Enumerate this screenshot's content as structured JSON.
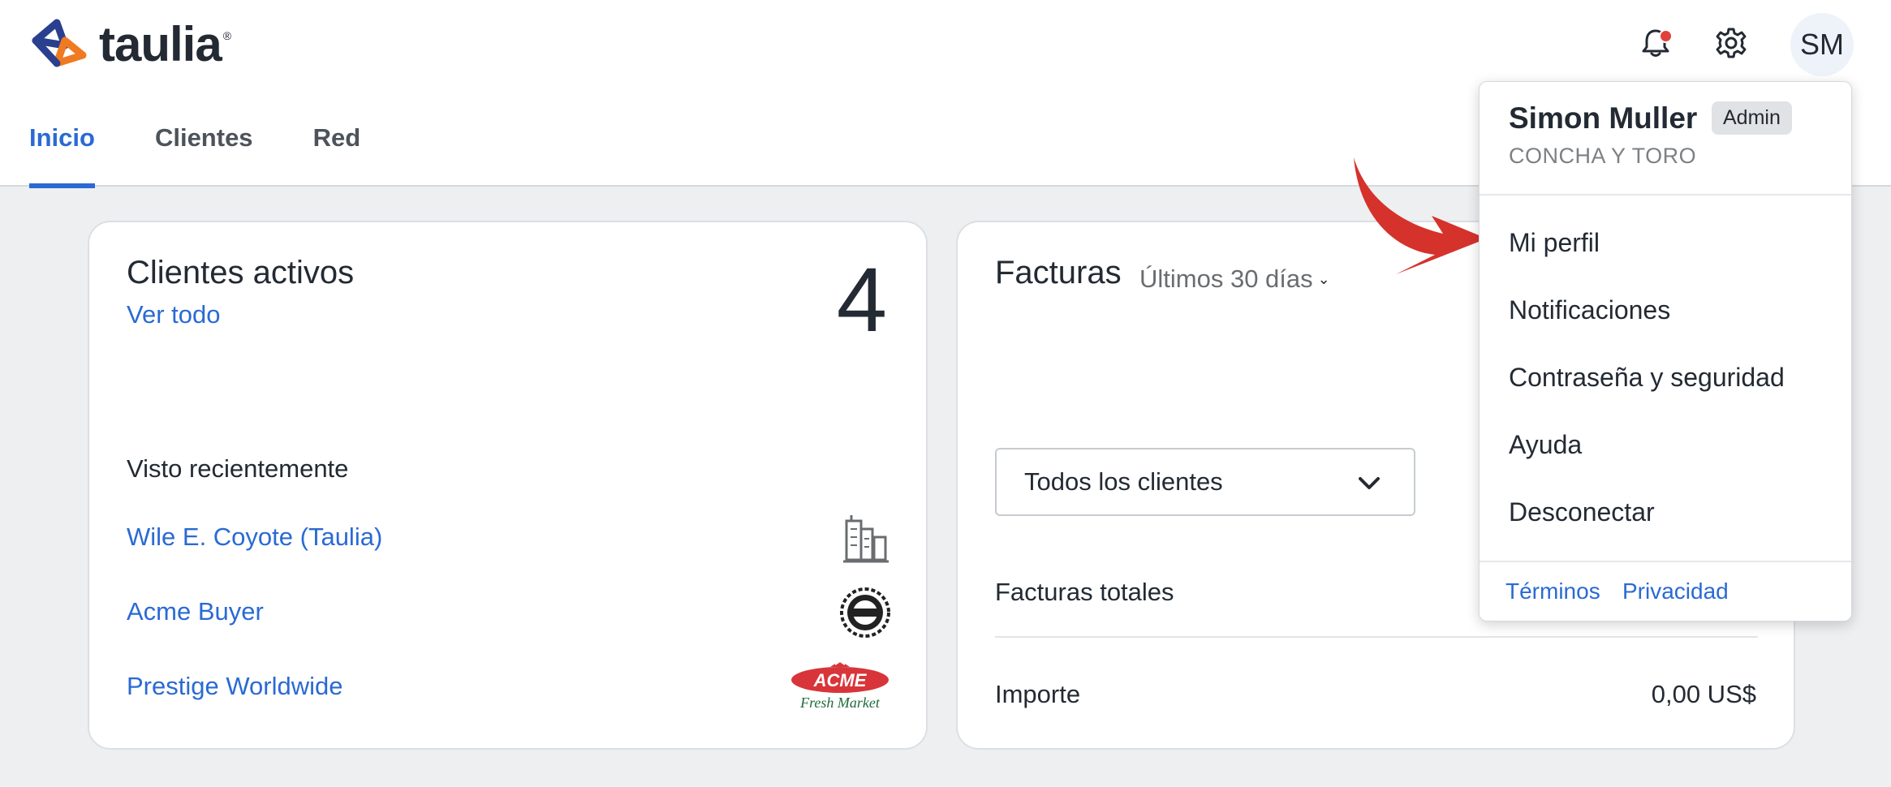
{
  "header": {
    "brand": "taulia",
    "brand_reg": "®",
    "avatar_initials": "SM",
    "notification_dot_color": "#e0423b"
  },
  "tabs": [
    {
      "label": "Inicio",
      "active": true
    },
    {
      "label": "Clientes",
      "active": false
    },
    {
      "label": "Red",
      "active": false
    }
  ],
  "active_clients": {
    "title": "Clientes activos",
    "view_all": "Ver todo",
    "count": "4",
    "recent_label": "Visto recientemente",
    "recent": [
      {
        "name": "Wile E. Coyote (Taulia)",
        "icon": "building-icon"
      },
      {
        "name": "Acme Buyer",
        "icon": "acme-seal-logo"
      },
      {
        "name": "Prestige Worldwide",
        "icon": "acme-fresh-market-logo",
        "logo_text": "ACME",
        "logo_subtext": "Fresh Market"
      }
    ]
  },
  "invoices": {
    "title": "Facturas",
    "range": "Últimos 30 días",
    "client_select": "Todos los clientes",
    "rows": [
      {
        "label": "Facturas totales",
        "value": ""
      },
      {
        "label": "Importe",
        "value": "0,00 US$"
      }
    ]
  },
  "user_menu": {
    "name": "Simon Muller",
    "role_badge": "Admin",
    "company": "CONCHA Y TORO",
    "items": [
      "Mi perfil",
      "Notificaciones",
      "Contraseña y seguridad",
      "Ayuda",
      "Desconectar"
    ],
    "footer_links": [
      "Términos",
      "Privacidad"
    ]
  },
  "colors": {
    "accent": "#2a6ad3",
    "annotation_arrow": "#d5322c",
    "background": "#eeeff1"
  }
}
